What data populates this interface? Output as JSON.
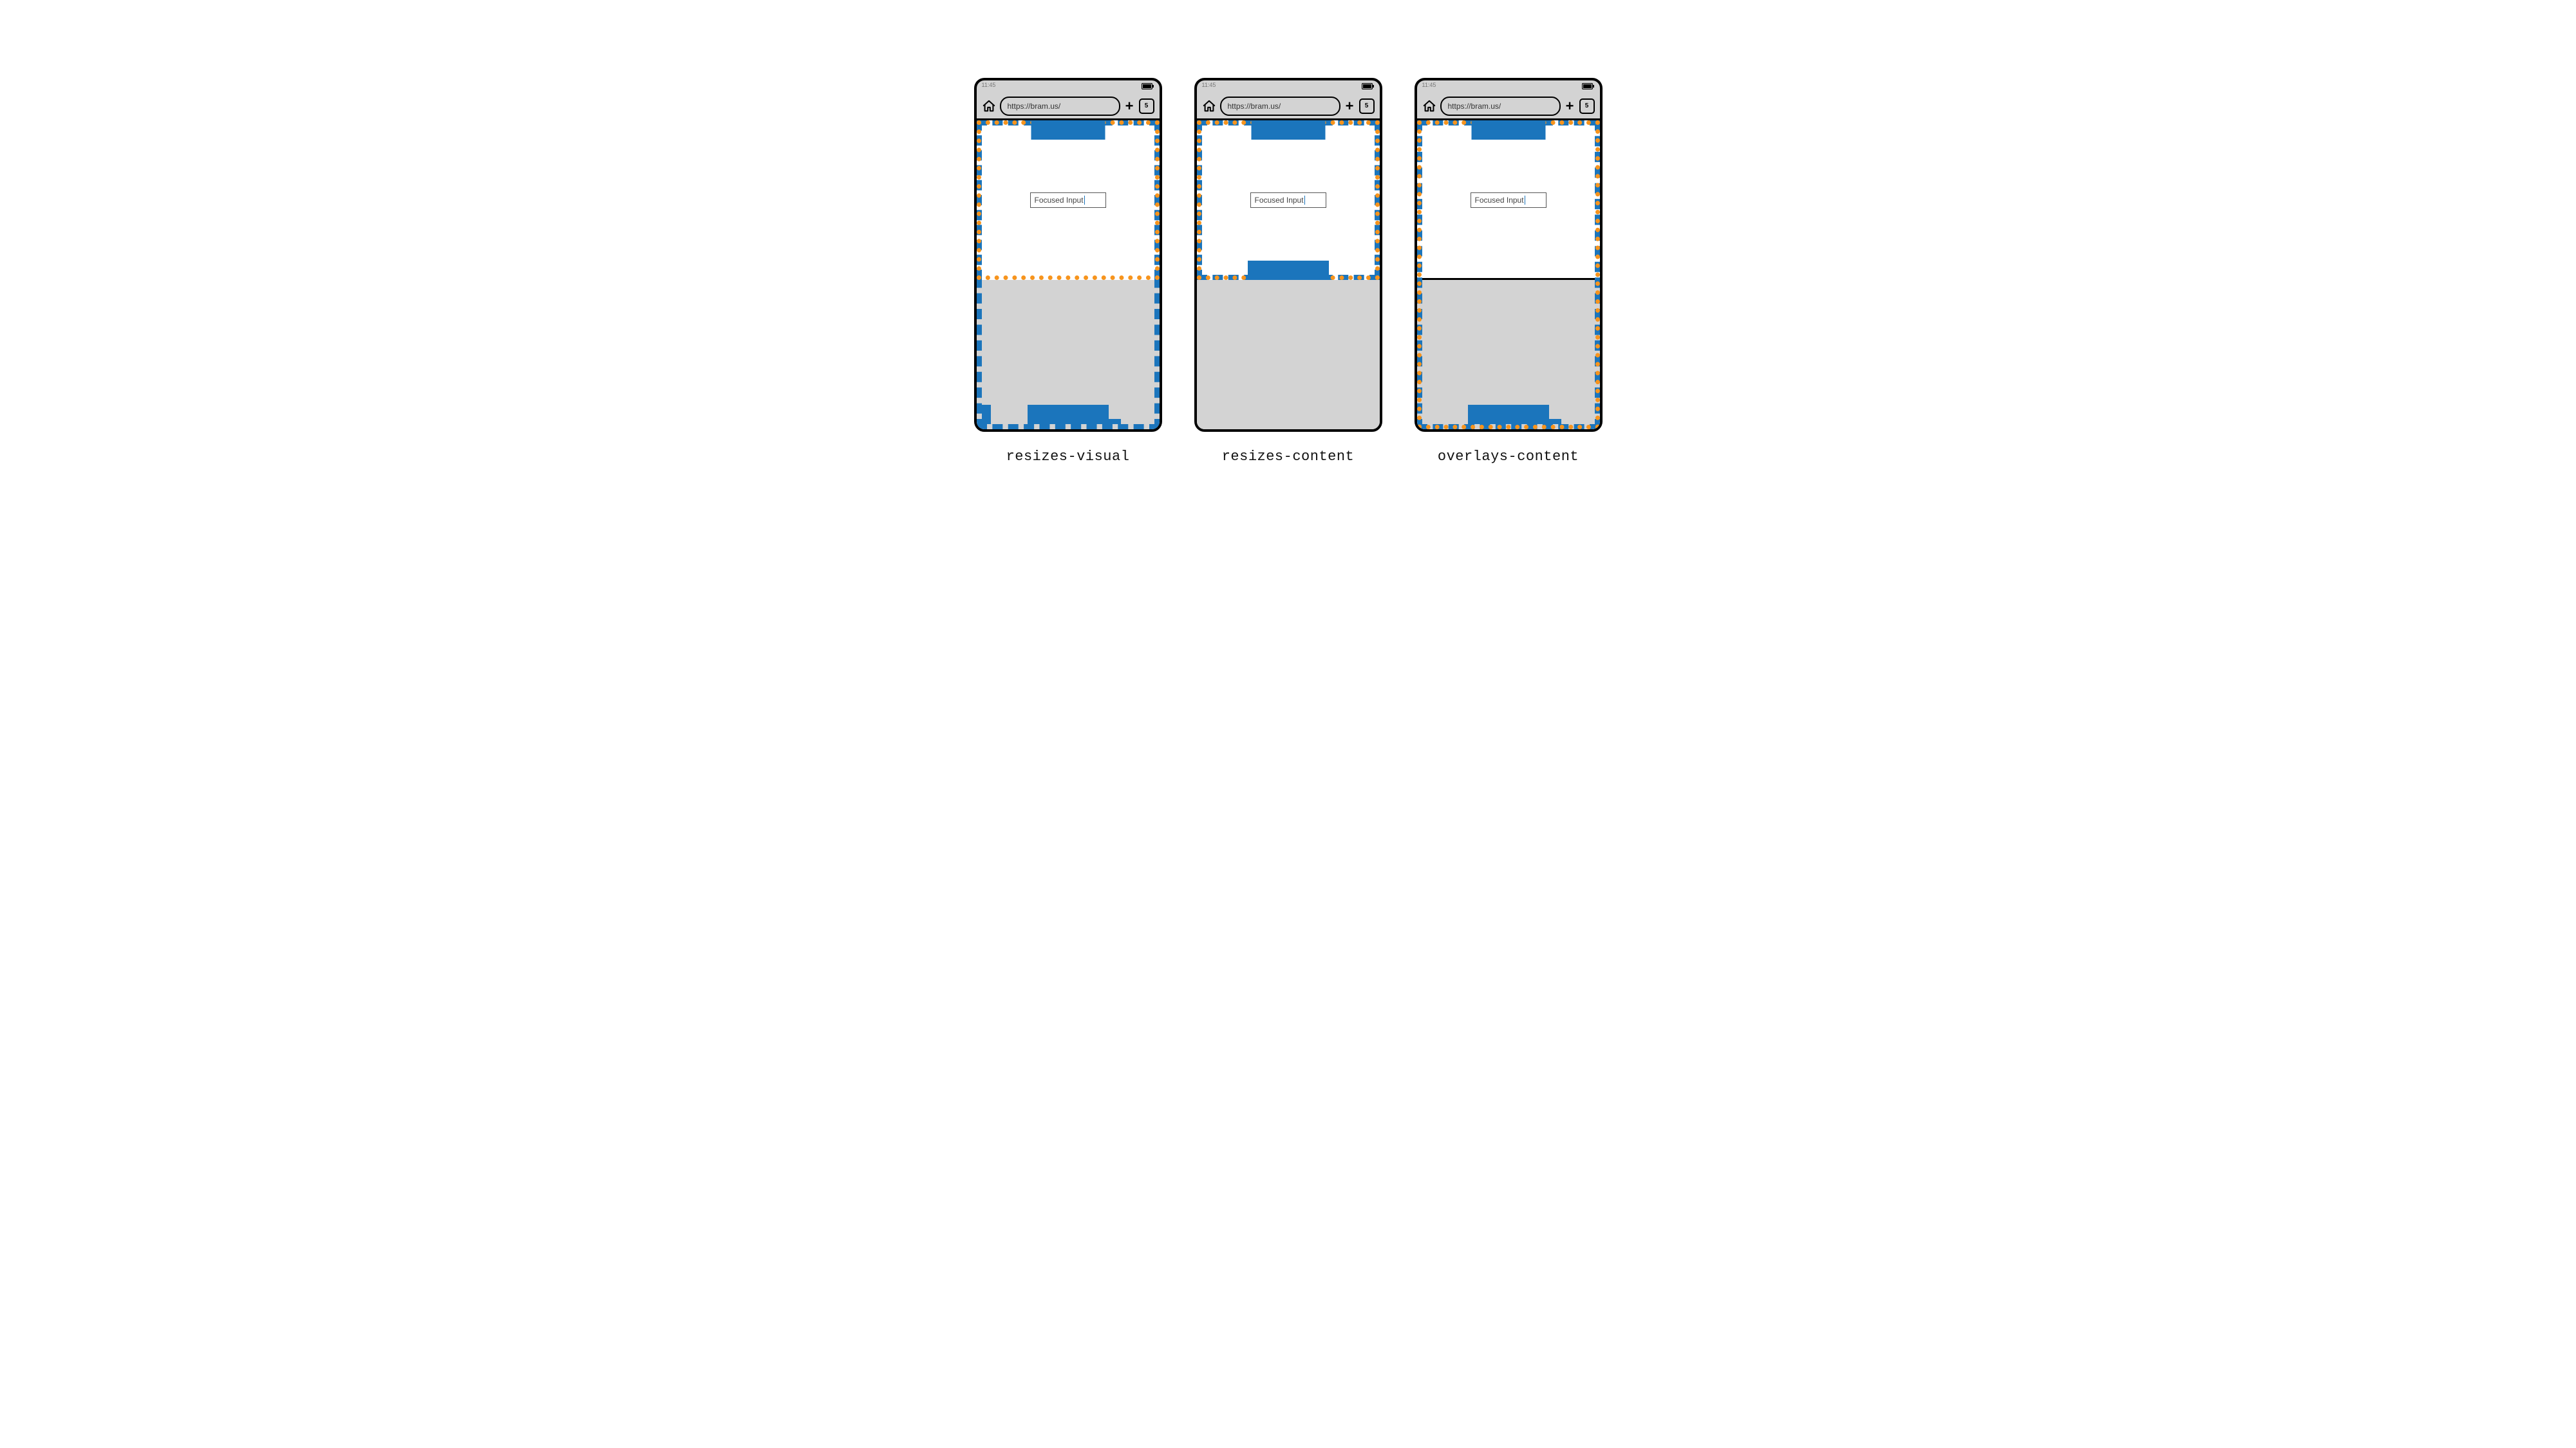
{
  "labels": {
    "resizes_visual": "resizes-visual",
    "resizes_content": "resizes-content",
    "overlays_content": "overlays-content"
  },
  "status": {
    "clock": "11:45"
  },
  "chrome": {
    "url": "https://bram.us/",
    "tab_count": "5",
    "new_tab_glyph": "+"
  },
  "input": {
    "label": "Focused Input"
  },
  "colors": {
    "blue": "#1b75bc",
    "orange": "#f7941d",
    "gray": "#d3d3d3"
  }
}
